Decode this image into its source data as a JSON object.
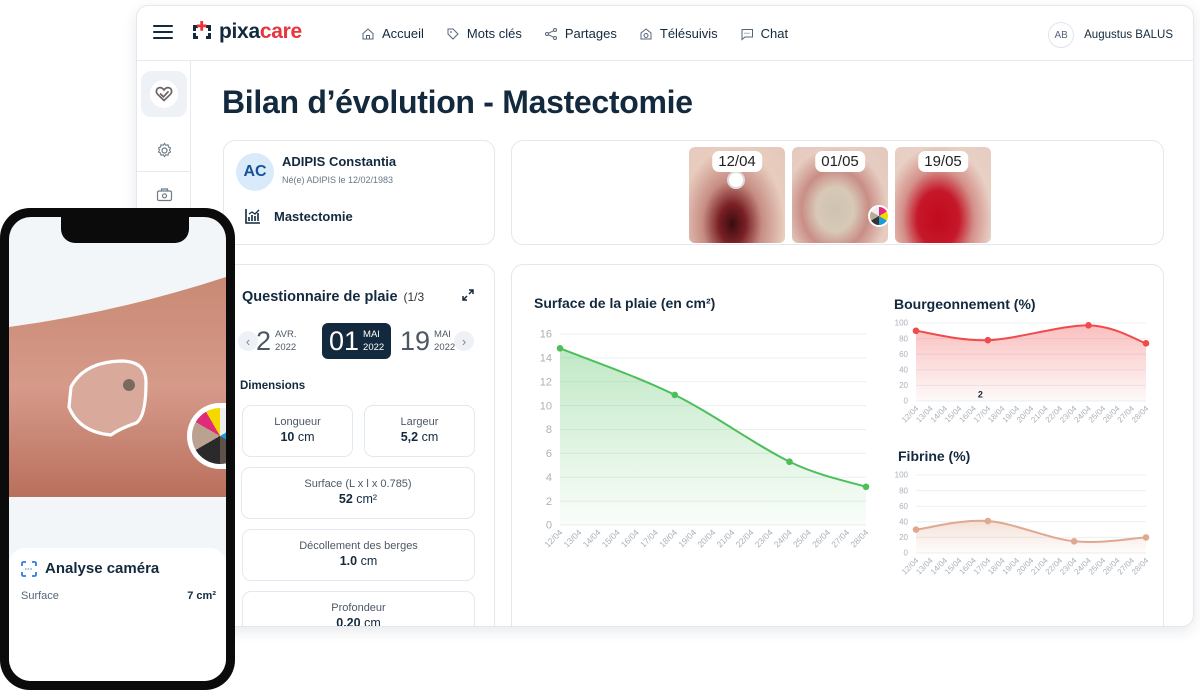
{
  "app": {
    "logo_prefix": "pixa",
    "logo_suffix": "care",
    "brand_color": "#e8353b",
    "dark_color": "#13293d"
  },
  "nav": [
    {
      "label": "Accueil",
      "icon": "home-icon"
    },
    {
      "label": "Mots clés",
      "icon": "tag-icon"
    },
    {
      "label": "Partages",
      "icon": "share-icon"
    },
    {
      "label": "Télésuivis",
      "icon": "telemonitoring-icon"
    },
    {
      "label": "Chat",
      "icon": "chat-icon"
    }
  ],
  "user": {
    "initials": "AB",
    "name": "Augustus BALUS"
  },
  "sidebar": [
    {
      "name": "wound-care",
      "icon": "heart-bandage-icon",
      "active": true
    },
    {
      "name": "settings",
      "icon": "gear-icon"
    },
    {
      "name": "camera",
      "icon": "camera-icon"
    }
  ],
  "page": {
    "title": "Bilan d’évolution - Mastectomie"
  },
  "patient": {
    "initials": "AC",
    "name": "ADIPIS Constantia",
    "sub": "Né(e) ADIPIS le 12/02/1983",
    "diagnosis": "Mastectomie"
  },
  "photos": [
    {
      "date": "12/04"
    },
    {
      "date": "01/05"
    },
    {
      "date": "19/05"
    }
  ],
  "questionnaire": {
    "title": "Questionnaire de plaie",
    "count": "(1/3",
    "dates": [
      {
        "day": "2",
        "month": "AVR.",
        "year": "2022"
      },
      {
        "day": "01",
        "month": "MAI",
        "year": "2022",
        "selected": true
      },
      {
        "day": "19",
        "month": "MAI",
        "year": "2022"
      }
    ],
    "section": "Dimensions",
    "metrics": [
      {
        "label": "Longueur",
        "value": "10",
        "unit": " cm"
      },
      {
        "label": "Largeur",
        "value": "5,2",
        "unit": " cm"
      },
      {
        "label": "Surface (L x l x 0.785)",
        "value": "52",
        "unit": " cm²"
      },
      {
        "label": "Décollement des berges",
        "value": "1.0",
        "unit": " cm"
      },
      {
        "label": "Profondeur",
        "value": "0.20",
        "unit": " cm"
      }
    ]
  },
  "phone": {
    "panel_title": "Analyse caméra",
    "row_label": "Surface",
    "row_value": "7 cm²"
  },
  "chart_data": [
    {
      "type": "area",
      "title": "Surface de la plaie (en cm²)",
      "categories": [
        "12/04",
        "13/04",
        "14/04",
        "15/04",
        "16/04",
        "17/04",
        "18/04",
        "19/04",
        "20/04",
        "21/04",
        "22/04",
        "23/04",
        "24/04",
        "25/04",
        "26/04",
        "27/04",
        "28/04"
      ],
      "points": [
        {
          "x": "12/04",
          "y": 14.8
        },
        {
          "x": "18/04",
          "y": 10.9
        },
        {
          "x": "24/04",
          "y": 5.3
        },
        {
          "x": "28/04",
          "y": 3.2
        }
      ],
      "ylim": [
        0,
        16
      ],
      "yticks": [
        0,
        2,
        4,
        6,
        8,
        10,
        12,
        14,
        16
      ],
      "color": "#4cbf5a",
      "grid": true
    },
    {
      "type": "area",
      "title": "Bourgeonnement (%)",
      "categories": [
        "12/04",
        "13/04",
        "14/04",
        "15/04",
        "16/04",
        "17/04",
        "18/04",
        "19/04",
        "20/04",
        "21/04",
        "22/04",
        "23/04",
        "24/04",
        "25/04",
        "26/04",
        "27/04",
        "28/04"
      ],
      "points": [
        {
          "x": "12/04",
          "y": 90
        },
        {
          "x": "17/04",
          "y": 78
        },
        {
          "x": "24/04",
          "y": 97
        },
        {
          "x": "28/04",
          "y": 74
        }
      ],
      "ylim": [
        0,
        100
      ],
      "yticks": [
        0,
        20,
        40,
        60,
        80,
        100
      ],
      "color": "#f04a4a",
      "annotation": "2",
      "grid": true
    },
    {
      "type": "area",
      "title": "Fibrine (%)",
      "categories": [
        "12/04",
        "13/04",
        "14/04",
        "15/04",
        "16/04",
        "17/04",
        "18/04",
        "19/04",
        "20/04",
        "21/04",
        "22/04",
        "23/04",
        "24/04",
        "25/04",
        "26/04",
        "27/04",
        "28/04"
      ],
      "points": [
        {
          "x": "12/04",
          "y": 30
        },
        {
          "x": "17/04",
          "y": 41
        },
        {
          "x": "23/04",
          "y": 15
        },
        {
          "x": "28/04",
          "y": 20
        }
      ],
      "ylim": [
        0,
        100
      ],
      "yticks": [
        0,
        20,
        40,
        60,
        80,
        100
      ],
      "color": "#e0a98f",
      "grid": true
    }
  ]
}
